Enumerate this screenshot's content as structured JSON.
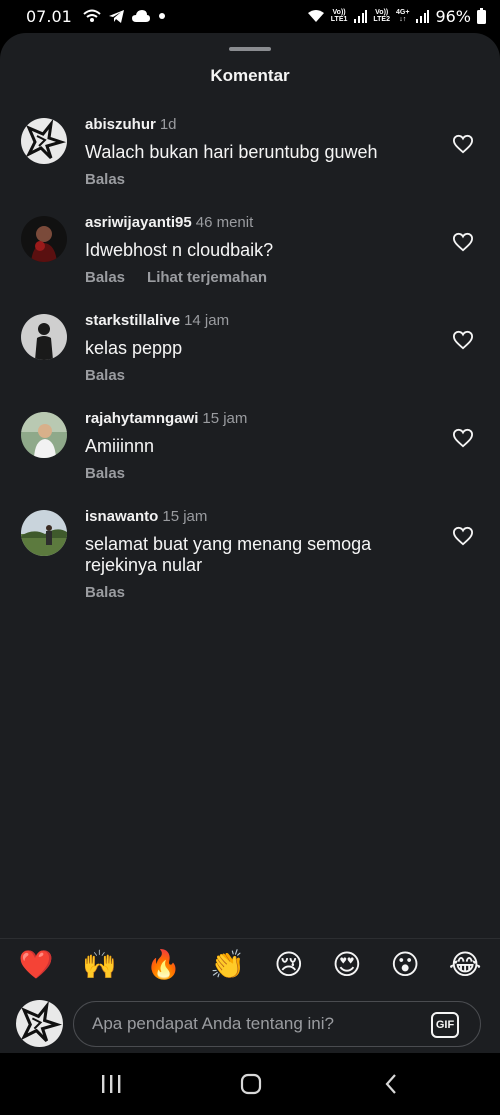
{
  "status_bar": {
    "time": "07.01",
    "sim1_top": "Vo))",
    "sim1_bottom": "LTE1",
    "sim2_top": "Vo))",
    "sim2_bottom": "LTE2",
    "sim2_net_top": "4G+",
    "sim2_net_bottom": "↓↑",
    "battery": "96%",
    "icons": [
      "wifi-calling-icon",
      "telegram-icon",
      "cloud-icon",
      "notification-dot-icon",
      "wifi-icon",
      "signal-icon",
      "battery-icon"
    ]
  },
  "sheet": {
    "title": "Komentar"
  },
  "comments": [
    {
      "username": "abiszuhur",
      "time": "1d",
      "text": "Walach bukan hari beruntubg guweh",
      "actions": [
        "Balas"
      ]
    },
    {
      "username": "asriwijayanti95",
      "time": "46 menit",
      "text": "Idwebhost n cloudbaik?",
      "actions": [
        "Balas",
        "Lihat terjemahan"
      ]
    },
    {
      "username": "starkstillalive",
      "time": "14 jam",
      "text": "kelas peppp",
      "actions": [
        "Balas"
      ]
    },
    {
      "username": "rajahytamngawi",
      "time": "15 jam",
      "text": "Amiiinnn",
      "actions": [
        "Balas"
      ]
    },
    {
      "username": "isnawanto",
      "time": "15 jam",
      "text": "selamat buat yang menang semoga rejekinya nular",
      "actions": [
        "Balas"
      ]
    }
  ],
  "emoji_bar": [
    "❤️",
    "🙌",
    "🔥",
    "👏",
    "😢",
    "😍",
    "😮",
    "😂"
  ],
  "comment_input": {
    "placeholder": "Apa pendapat Anda tentang ini?",
    "value": "",
    "gif_label": "GIF"
  },
  "colors": {
    "sheet_bg": "#1c1e21",
    "secondary_text": "#9a9ca0",
    "status_bg": "#000000"
  }
}
